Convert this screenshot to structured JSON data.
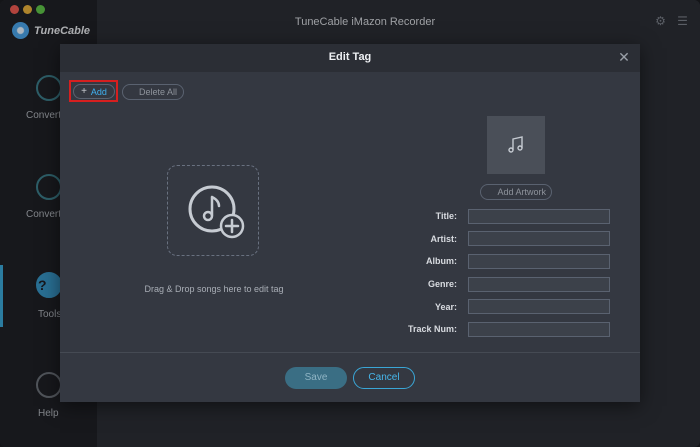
{
  "app": {
    "brand": "TuneCable",
    "window_title": "TuneCable iMazon Recorder"
  },
  "sidebar": {
    "items": [
      {
        "label": "Convert",
        "icon": "convert-icon"
      },
      {
        "label": "Converted",
        "icon": "clock-icon"
      },
      {
        "label": "Tools",
        "icon": "tools-icon",
        "active": true
      },
      {
        "label": "Help",
        "icon": "help-icon"
      }
    ]
  },
  "dialog": {
    "title": "Edit Tag",
    "add_label": "Add",
    "delete_all_label": "Delete All",
    "drop_text": "Drag & Drop songs here to edit tag",
    "add_artwork_label": "Add Artwork",
    "fields": [
      {
        "label": "Title:",
        "value": ""
      },
      {
        "label": "Artist:",
        "value": ""
      },
      {
        "label": "Album:",
        "value": ""
      },
      {
        "label": "Genre:",
        "value": ""
      },
      {
        "label": "Year:",
        "value": ""
      },
      {
        "label": "Track Num:",
        "value": ""
      }
    ],
    "save_label": "Save",
    "cancel_label": "Cancel"
  },
  "colors": {
    "accent": "#3aa6d6",
    "highlight": "#d61f1f",
    "background": "#2b2e35",
    "dialog": "#343841"
  }
}
